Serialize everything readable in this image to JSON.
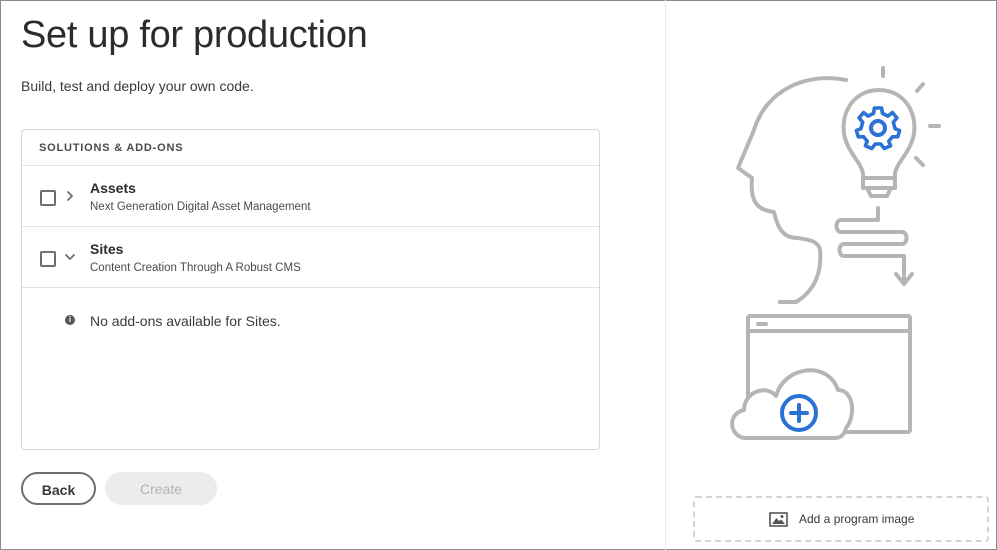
{
  "page": {
    "title": "Set up for production",
    "subtitle": "Build, test and deploy your own code."
  },
  "solutions": {
    "header": "SOLUTIONS & ADD-ONS",
    "items": [
      {
        "title": "Assets",
        "description": "Next Generation Digital Asset Management",
        "checked": false,
        "expanded": false
      },
      {
        "title": "Sites",
        "description": "Content Creation Through A Robust CMS",
        "checked": false,
        "expanded": true
      }
    ],
    "addons_notice": "No add-ons available for Sites."
  },
  "actions": {
    "back_label": "Back",
    "create_label": "Create"
  },
  "sidebar": {
    "add_image_label": "Add a program image"
  },
  "icons": {
    "info": "info-icon",
    "chevron_right": "chevron-right-icon",
    "chevron_down": "chevron-down-icon",
    "image": "image-icon",
    "gear": "gear-icon",
    "plus": "plus-icon"
  },
  "colors": {
    "accent": "#2b72d7",
    "illustration_gray": "#b5b5b5",
    "disabled_bg": "#ececec",
    "disabled_text": "#b3b3b3"
  }
}
